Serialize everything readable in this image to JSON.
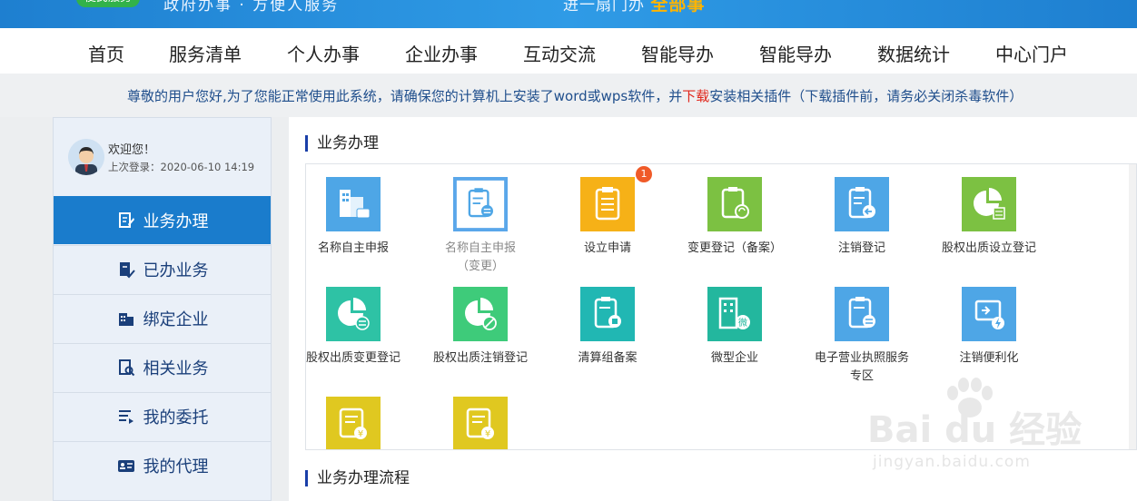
{
  "banner": {
    "badge": "便民服务",
    "slogan": "政府办事 · 方便人服务",
    "tagline_prefix": "进一扇门办",
    "tagline_highlight": "全部事",
    "brand_color": "#1e7fd0"
  },
  "nav": {
    "items": [
      {
        "label": "首页"
      },
      {
        "label": "服务清单"
      },
      {
        "label": "个人办事"
      },
      {
        "label": "企业办事"
      },
      {
        "label": "互动交流"
      },
      {
        "label": "智能导办"
      },
      {
        "label": "智能导办"
      },
      {
        "label": "数据统计"
      },
      {
        "label": "中心门户"
      }
    ]
  },
  "notice": {
    "part1": "尊敬的用户您好,为了您能正常使用此系统，请确保您的计算机上安装了word或wps软件，并",
    "link": "下载",
    "part2": "安装相关插件（下载插件前，请务必关闭杀毒软件）"
  },
  "user": {
    "welcome": "欢迎您！",
    "last_login": "上次登录：2020-06-10 14:19",
    "avatar_icon": "user-avatar-icon"
  },
  "sidebar": {
    "items": [
      {
        "label": "业务办理",
        "icon": "edit-doc-icon",
        "active": true
      },
      {
        "label": "已办业务",
        "icon": "doc-check-icon"
      },
      {
        "label": "绑定企业",
        "icon": "building-icon"
      },
      {
        "label": "相关业务",
        "icon": "doc-search-icon"
      },
      {
        "label": "我的委托",
        "icon": "list-arrow-icon"
      },
      {
        "label": "我的代理",
        "icon": "id-card-icon"
      }
    ],
    "active_color": "#1a7ccc"
  },
  "main": {
    "section1_title": "业务办理",
    "section2_title": "业务办理流程",
    "tiles": [
      {
        "label": "名称自主申报",
        "color": "#4ea6e6",
        "icon": "building-name-icon"
      },
      {
        "label": "名称自主申报（变更）",
        "color": "#ffffff",
        "icon": "clipboard-change-icon",
        "outline": true
      },
      {
        "label": "设立申请",
        "color": "#f6b117",
        "icon": "clipboard-icon",
        "badge": "1"
      },
      {
        "label": "变更登记（备案）",
        "color": "#7cc142",
        "icon": "clipboard-refresh-icon"
      },
      {
        "label": "注销登记",
        "color": "#4ea6e6",
        "icon": "clipboard-back-icon"
      },
      {
        "label": "股权出质设立登记",
        "color": "#7cc142",
        "icon": "pie-doc-icon"
      },
      {
        "label": "股权出质变更登记",
        "color": "#2ec2a5",
        "icon": "pie-swap-icon"
      },
      {
        "label": "股权出质注销登记",
        "color": "#3ecb7a",
        "icon": "pie-cancel-icon"
      },
      {
        "label": "清算组备案",
        "color": "#21b7b3",
        "icon": "clipboard-stamp-icon"
      },
      {
        "label": "微型企业",
        "color": "#23b79e",
        "icon": "building-micro-icon"
      },
      {
        "label": "电子营业执照服务专区",
        "color": "#4ea6e6",
        "icon": "clipboard-swap-icon"
      },
      {
        "label": "注销便利化",
        "color": "#4ea6e6",
        "icon": "doc-flash-icon"
      },
      {
        "label": "",
        "color": "#e0c820",
        "icon": "yen-doc-icon"
      },
      {
        "label": "",
        "color": "#e0c820",
        "icon": "yen-doc-icon"
      }
    ]
  },
  "watermark": {
    "brand": "Bai du 经验",
    "url": "jingyan.baidu.com"
  }
}
